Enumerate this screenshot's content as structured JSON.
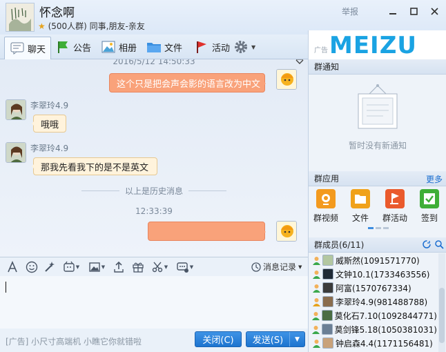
{
  "window": {
    "group_name": "怀念啊",
    "group_info": "(500人群) 同事,朋友-亲友",
    "report_label": "举报"
  },
  "toolbar": {
    "tabs": [
      {
        "label": "聊天"
      },
      {
        "label": "公告"
      },
      {
        "label": "相册"
      },
      {
        "label": "文件"
      },
      {
        "label": "活动"
      }
    ]
  },
  "ad_banner": {
    "tag": "广告",
    "brand": "MEIZU"
  },
  "chat": {
    "messages": [
      {
        "time": "2016/5/12 14:50:33",
        "side": "right",
        "text": "这个只是把会声会影的语言改为中文"
      },
      {
        "sender": "李翠玲4.9",
        "side": "left",
        "text": "哦哦"
      },
      {
        "sender": "李翠玲4.9",
        "side": "left",
        "text": "那我先看我下的是不是英文"
      },
      {
        "history_divider": "以上是历史消息"
      },
      {
        "time": "12:33:39",
        "side": "right",
        "text": ""
      }
    ]
  },
  "input": {
    "message_record_label": "消息记录",
    "ad_text": "[广告] 小尺寸高端机 小瞧它你就错啦",
    "close_button": "关闭(C)",
    "send_button": "发送(S)"
  },
  "right_panel": {
    "notice_title": "群通知",
    "notice_empty": "暂时没有新通知",
    "apps_title": "群应用",
    "apps_more": "更多",
    "apps": [
      {
        "label": "群视频",
        "color": "#f39a1e"
      },
      {
        "label": "文件",
        "color": "#f0a21a"
      },
      {
        "label": "群活动",
        "color": "#ea5a2c"
      },
      {
        "label": "签到",
        "color": "#3fae37"
      }
    ],
    "members_title": "群成员(6/11)",
    "members": [
      {
        "name": "威斯然(1091571770)"
      },
      {
        "name": "文钟10.1(1733463556)"
      },
      {
        "name": "阿富(1570767334)"
      },
      {
        "name": "李翠玲4.9(981488788)"
      },
      {
        "name": "莫化石7.10(1092844771)"
      },
      {
        "name": "莫剑锋5.18(1050381031)"
      },
      {
        "name": "钟启森4.4(1171156481)"
      }
    ]
  }
}
